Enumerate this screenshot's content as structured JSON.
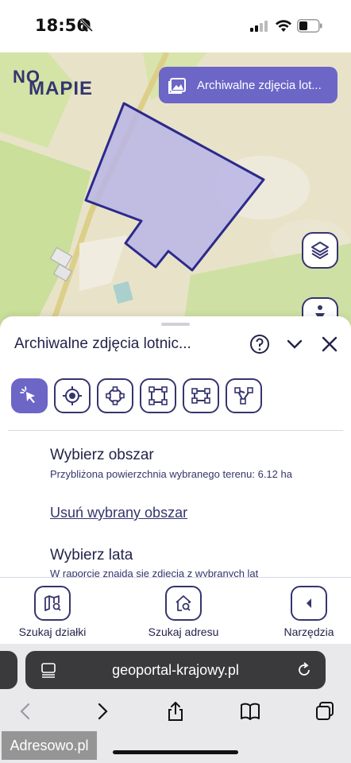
{
  "status_bar": {
    "time": "18:56"
  },
  "map": {
    "logo_top": "NO",
    "logo_bottom": "MAPIE",
    "archive_chip": "Archiwalne zdjęcia lot..."
  },
  "sheet": {
    "title": "Archiwalne zdjęcia lotnic...",
    "tools": [
      "pointer-icon",
      "locate-icon",
      "point-shape-icon",
      "rectangle-icon",
      "box-icon",
      "polyline-icon"
    ],
    "section1": {
      "title": "Wybierz obszar",
      "desc": "Przybliżona powierzchnia wybranego terenu: 6.12 ha",
      "link": "Usuń wybrany obszar"
    },
    "section2": {
      "title": "Wybierz lata",
      "desc": "W raporcie znajdą się zdjęcia z wybranych lat"
    }
  },
  "bottom_nav": {
    "items": [
      {
        "label": "Szukaj działki",
        "icon": "map-search-icon"
      },
      {
        "label": "Szukaj adresu",
        "icon": "home-search-icon"
      },
      {
        "label": "Narzędzia",
        "icon": "arrow-left-icon"
      }
    ]
  },
  "safari": {
    "url": "geoportal-krajowy.pl"
  },
  "watermark": "Adresowo.pl",
  "colors": {
    "accent": "#6c66c7",
    "dark": "#35356e",
    "polygon_fill": "#b8b5e6"
  }
}
